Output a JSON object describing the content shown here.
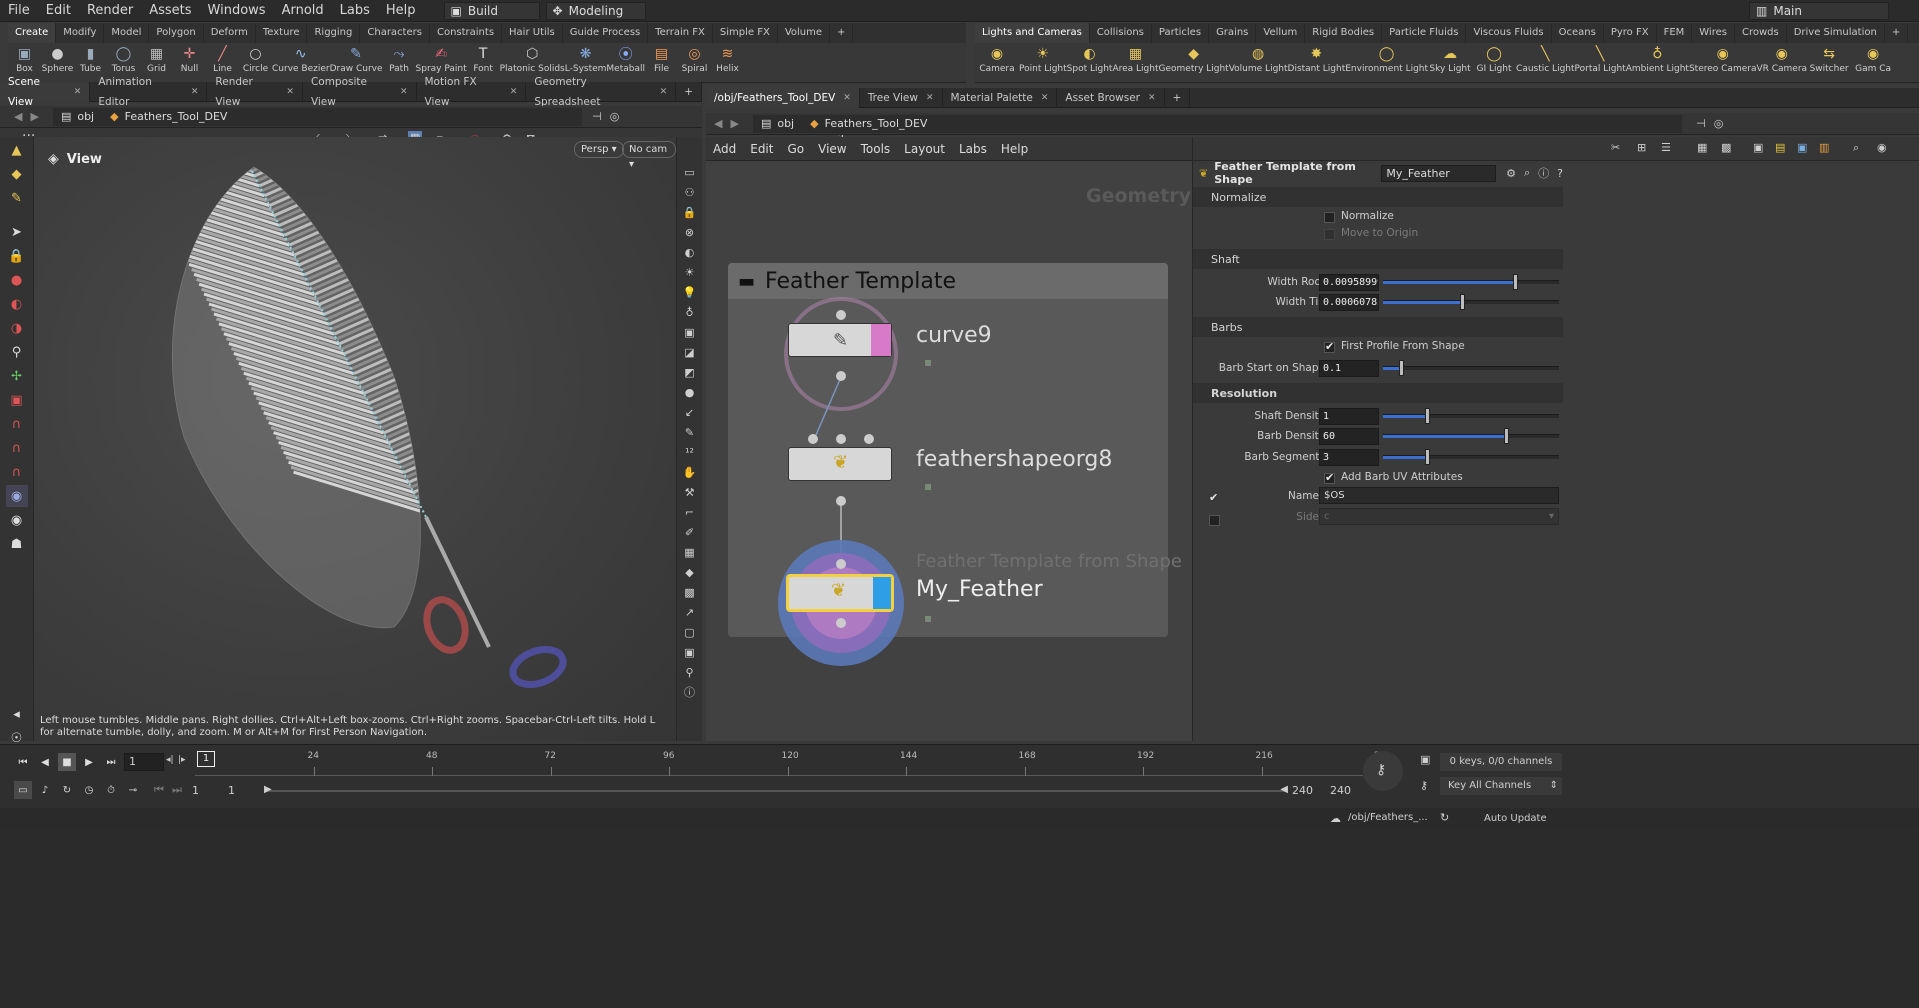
{
  "menubar": {
    "items": [
      "File",
      "Edit",
      "Render",
      "Assets",
      "Windows",
      "Arnold",
      "Labs",
      "Help"
    ],
    "build": "Build",
    "desktop": "Modeling",
    "main": "Main"
  },
  "shelf_tabs_left": [
    "Create",
    "Modify",
    "Model",
    "Polygon",
    "Deform",
    "Texture",
    "Rigging",
    "Characters",
    "Constraints",
    "Hair Utils",
    "Guide Process",
    "Terrain FX",
    "Simple FX",
    "Volume"
  ],
  "shelf_tabs_right": [
    "Lights and Cameras",
    "Collisions",
    "Particles",
    "Grains",
    "Vellum",
    "Rigid Bodies",
    "Particle Fluids",
    "Viscous Fluids",
    "Oceans",
    "Pyro FX",
    "FEM",
    "Wires",
    "Crowds",
    "Drive Simulation"
  ],
  "tools_left": [
    "Box",
    "Sphere",
    "Tube",
    "Torus",
    "Grid",
    "Null",
    "Line",
    "Circle",
    "Curve Bezier",
    "Draw Curve",
    "Path",
    "Spray Paint",
    "Font",
    "Platonic Solids",
    "L-System",
    "Metaball",
    "File",
    "Spiral",
    "Helix"
  ],
  "tools_right": [
    "Camera",
    "Point Light",
    "Spot Light",
    "Area Light",
    "Geometry Light",
    "Volume Light",
    "Distant Light",
    "Environment Light",
    "Sky Light",
    "GI Light",
    "Caustic Light",
    "Portal Light",
    "Ambient Light",
    "Stereo Camera",
    "VR Camera",
    "Switcher",
    "Gam Ca"
  ],
  "left_pane_tabs": [
    "Scene View",
    "Animation Editor",
    "Render View",
    "Composite View",
    "Motion FX View",
    "Geometry Spreadsheet"
  ],
  "right_pane_tabs": [
    "/obj/Feathers_Tool_DEV",
    "Tree View",
    "Material Palette",
    "Asset Browser"
  ],
  "left_path": {
    "obj": "obj",
    "node": "Feathers_Tool_DEV"
  },
  "right_path": {
    "obj": "obj",
    "node": "Feathers_Tool_DEV"
  },
  "viewport": {
    "title": "View",
    "persp": "Persp",
    "cam": "No cam",
    "help": "Left mouse tumbles. Middle pans. Right dollies. Ctrl+Alt+Left box-zooms. Ctrl+Right zooms. Spacebar-Ctrl-Left tilts. Hold L for alternate tumble, dolly, and zoom. M or Alt+M for First Person Navigation."
  },
  "network": {
    "menu": [
      "Add",
      "Edit",
      "Go",
      "View",
      "Tools",
      "Layout",
      "Labs",
      "Help"
    ],
    "context": "Geometry",
    "box_title": "Feather Template",
    "nodes": [
      "curve9",
      "feathershapeorg8",
      "My_Feather"
    ],
    "node_type_label": "Feather Template from Shape"
  },
  "params": {
    "header_type": "Feather Template from Shape",
    "header_name": "My_Feather",
    "sections": {
      "normalize": "Normalize",
      "shaft": "Shaft",
      "barbs": "Barbs",
      "resolution": "Resolution"
    },
    "normalize_label": "Normalize",
    "move_to_origin": "Move to Origin",
    "width_root": {
      "label": "Width Root",
      "value": "0.00958999",
      "fraction": 0.75
    },
    "width_tip": {
      "label": "Width Tip",
      "value": "0.00060783",
      "fraction": 0.45
    },
    "first_profile": "First Profile From Shape",
    "barb_start": {
      "label": "Barb Start on Shape",
      "value": "0.1",
      "fraction": 0.1
    },
    "shaft_density": {
      "label": "Shaft Density",
      "value": "1",
      "fraction": 0.25
    },
    "barb_density": {
      "label": "Barb Density",
      "value": "60",
      "fraction": 0.7
    },
    "barb_segments": {
      "label": "Barb Segments",
      "value": "3",
      "fraction": 0.25
    },
    "add_barb_uv": "Add Barb UV Attributes",
    "name": {
      "label": "Name",
      "value": "$OS"
    },
    "side": {
      "label": "Side",
      "value": "c"
    }
  },
  "timeline": {
    "current_frame": "1",
    "ticks": [
      "24",
      "48",
      "72",
      "96",
      "120",
      "144",
      "168",
      "192",
      "216",
      "2"
    ],
    "start": "1",
    "start2": "1",
    "end": "240",
    "end2": "240",
    "keys": "0 keys, 0/0 channels",
    "key_all": "Key All Channels"
  },
  "status": {
    "path": "/obj/Feathers_...",
    "update": "Auto Update"
  },
  "colors": {
    "accent": "#3b6fd4",
    "selected_node": "#f2d13c",
    "node_pink": "#d77ac8"
  }
}
